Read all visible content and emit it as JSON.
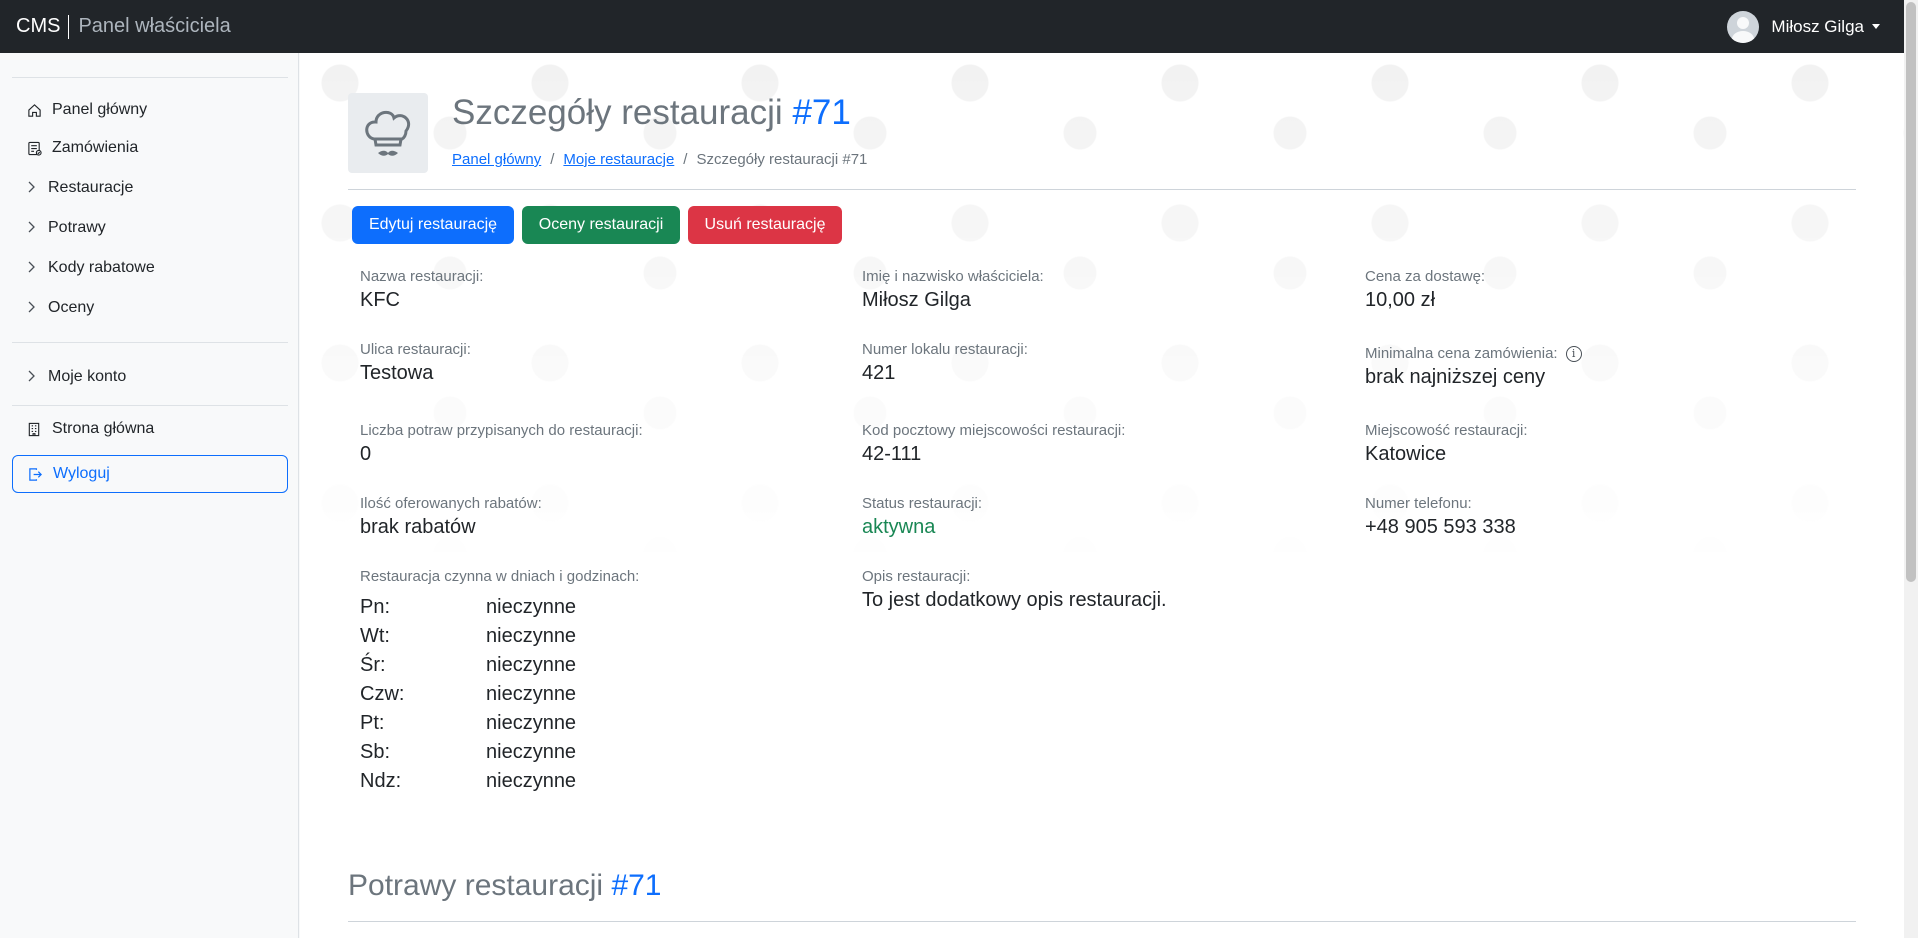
{
  "topbar": {
    "brand": "CMS",
    "brand_sub": "Panel właściciela",
    "user_name": "Miłosz Gilga"
  },
  "sidebar": {
    "items": [
      {
        "label": "Panel główny",
        "icon": "home-icon"
      },
      {
        "label": "Zamówienia",
        "icon": "orders-icon"
      },
      {
        "label": "Restauracje",
        "icon": "chevron-right-icon"
      },
      {
        "label": "Potrawy",
        "icon": "chevron-right-icon"
      },
      {
        "label": "Kody rabatowe",
        "icon": "chevron-right-icon"
      },
      {
        "label": "Oceny",
        "icon": "chevron-right-icon"
      },
      {
        "label": "Moje konto",
        "icon": "chevron-right-icon"
      },
      {
        "label": "Strona główna",
        "icon": "building-icon"
      },
      {
        "label": "Wyloguj",
        "icon": "logout-icon"
      }
    ]
  },
  "page": {
    "title": "Szczegóły restauracji",
    "title_id": "#71",
    "breadcrumb": [
      "Panel główny",
      "Moje restauracje",
      "Szczegóły restauracji #71"
    ],
    "buttons": {
      "edit": "Edytuj restaurację",
      "ratings": "Oceny restauracji",
      "delete": "Usuń restaurację"
    },
    "colors": {
      "primary": "#0d6efd",
      "success": "#198754",
      "danger": "#dc3545"
    }
  },
  "details": {
    "name": {
      "label": "Nazwa restauracji:",
      "value": "KFC"
    },
    "street": {
      "label": "Ulica restauracji:",
      "value": "Testowa"
    },
    "dishes_count": {
      "label": "Liczba potraw przypisanych do restauracji:",
      "value": "0"
    },
    "discounts": {
      "label": "Ilość oferowanych rabatów:",
      "value": "brak rabatów"
    },
    "owner": {
      "label": "Imię i nazwisko właściciela:",
      "value": "Miłosz Gilga"
    },
    "local_number": {
      "label": "Numer lokalu restauracji:",
      "value": "421"
    },
    "postal_code": {
      "label": "Kod pocztowy miejscowości restauracji:",
      "value": "42-111"
    },
    "status": {
      "label": "Status restauracji:",
      "value": "aktywna"
    },
    "description": {
      "label": "Opis restauracji:",
      "value": "To jest dodatkowy opis restauracji."
    },
    "delivery_price": {
      "label": "Cena za dostawę:",
      "value": "10,00 zł"
    },
    "min_order": {
      "label": "Minimalna cena zamówienia:",
      "value": "brak najniższej ceny"
    },
    "city": {
      "label": "Miejscowość restauracji:",
      "value": "Katowice"
    },
    "phone": {
      "label": "Numer telefonu:",
      "value": "+48 905 593 338"
    }
  },
  "hours": {
    "label": "Restauracja czynna w dniach i godzinach:",
    "rows": [
      {
        "day": "Pn:",
        "value": "nieczynne"
      },
      {
        "day": "Wt:",
        "value": "nieczynne"
      },
      {
        "day": "Śr:",
        "value": "nieczynne"
      },
      {
        "day": "Czw:",
        "value": "nieczynne"
      },
      {
        "day": "Pt:",
        "value": "nieczynne"
      },
      {
        "day": "Sb:",
        "value": "nieczynne"
      },
      {
        "day": "Ndz:",
        "value": "nieczynne"
      }
    ]
  },
  "dishes_section": {
    "title": "Potrawy restauracji",
    "title_id": "#71"
  }
}
